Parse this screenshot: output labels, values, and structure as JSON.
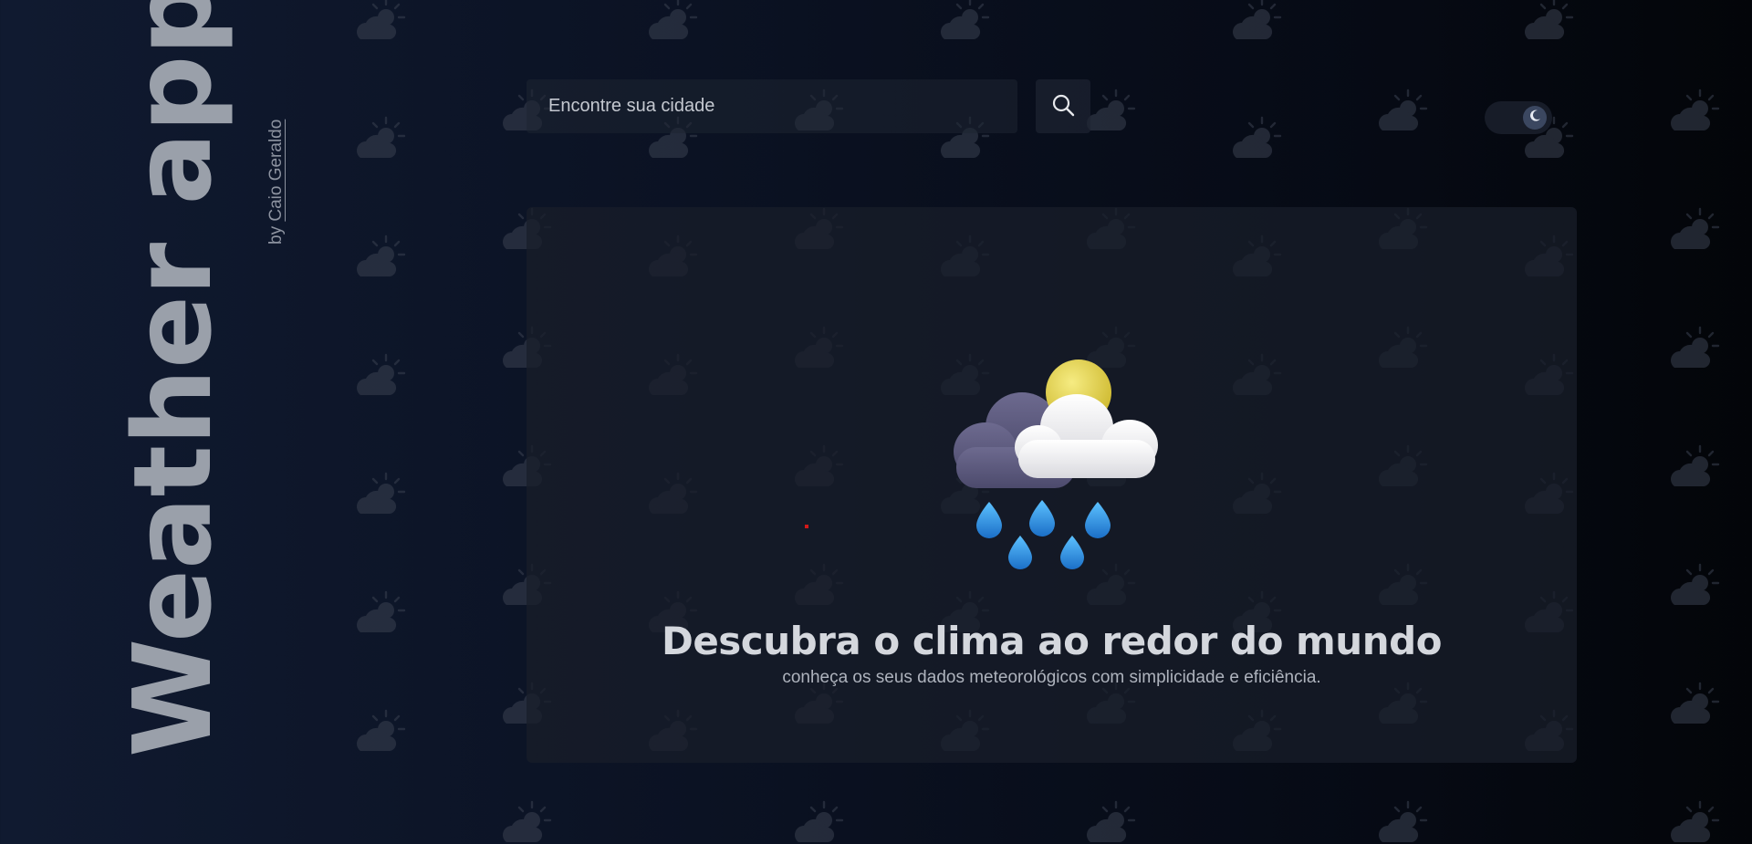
{
  "brand": {
    "title": "Weather app",
    "by_prefix": "by",
    "author": "Caio Geraldo"
  },
  "search": {
    "placeholder": "Encontre sua cidade",
    "value": "",
    "button_icon": "search-icon"
  },
  "theme_toggle": {
    "icon": "moon-icon",
    "mode": "dark"
  },
  "hero": {
    "icon": "rain-sun-cloud-icon",
    "headline": "Descubra o clima ao redor do mundo",
    "subline": "conheça os seus dados meteorológicos com simplicidade e eficiência."
  },
  "colors": {
    "background": "#0b1223",
    "card": "#181d2a",
    "title": "#9aa0aa",
    "accent_sun": "#e8d64a",
    "accent_drop": "#2a8fe0"
  }
}
